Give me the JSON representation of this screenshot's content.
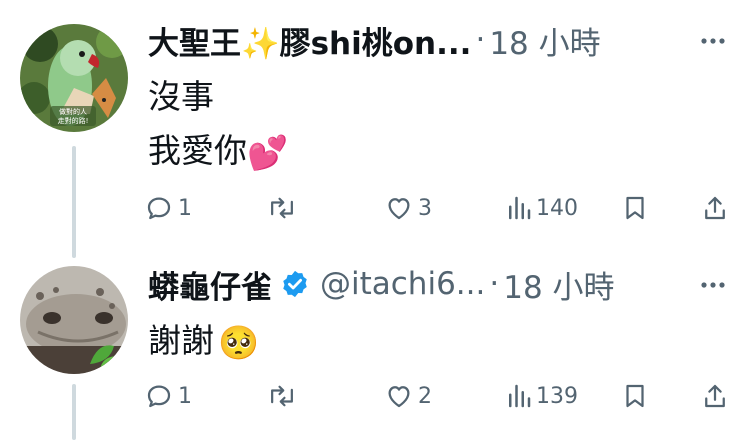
{
  "tweets": [
    {
      "display_name": "大聖王✨膠shi桃on...",
      "separator": "·",
      "time": "18 小時",
      "body_lines": [
        "沒事",
        "我愛你"
      ],
      "body_emoji": "💕",
      "avatar_caption": "做對的人 走對的路!",
      "stats": {
        "replies": "1",
        "retweets": "",
        "likes": "3",
        "views": "140"
      }
    },
    {
      "display_name": "蟒龜仔雀",
      "handle": "@itachi6...",
      "separator": "·",
      "time": "18 小時",
      "body_lines": [
        "謝謝"
      ],
      "body_emoji": "🥺",
      "stats": {
        "replies": "1",
        "retweets": "",
        "likes": "2",
        "views": "139"
      }
    }
  ],
  "icons": [
    "more-icon",
    "reply-icon",
    "retweet-icon",
    "like-icon",
    "views-icon",
    "bookmark-icon",
    "share-icon",
    "verified-icon"
  ],
  "colors": {
    "verified_blue": "#1d9bf0",
    "muted": "#536471",
    "text": "#0f1419",
    "thread_line": "#cfd9de",
    "heart_pink": "#f74a9c"
  }
}
